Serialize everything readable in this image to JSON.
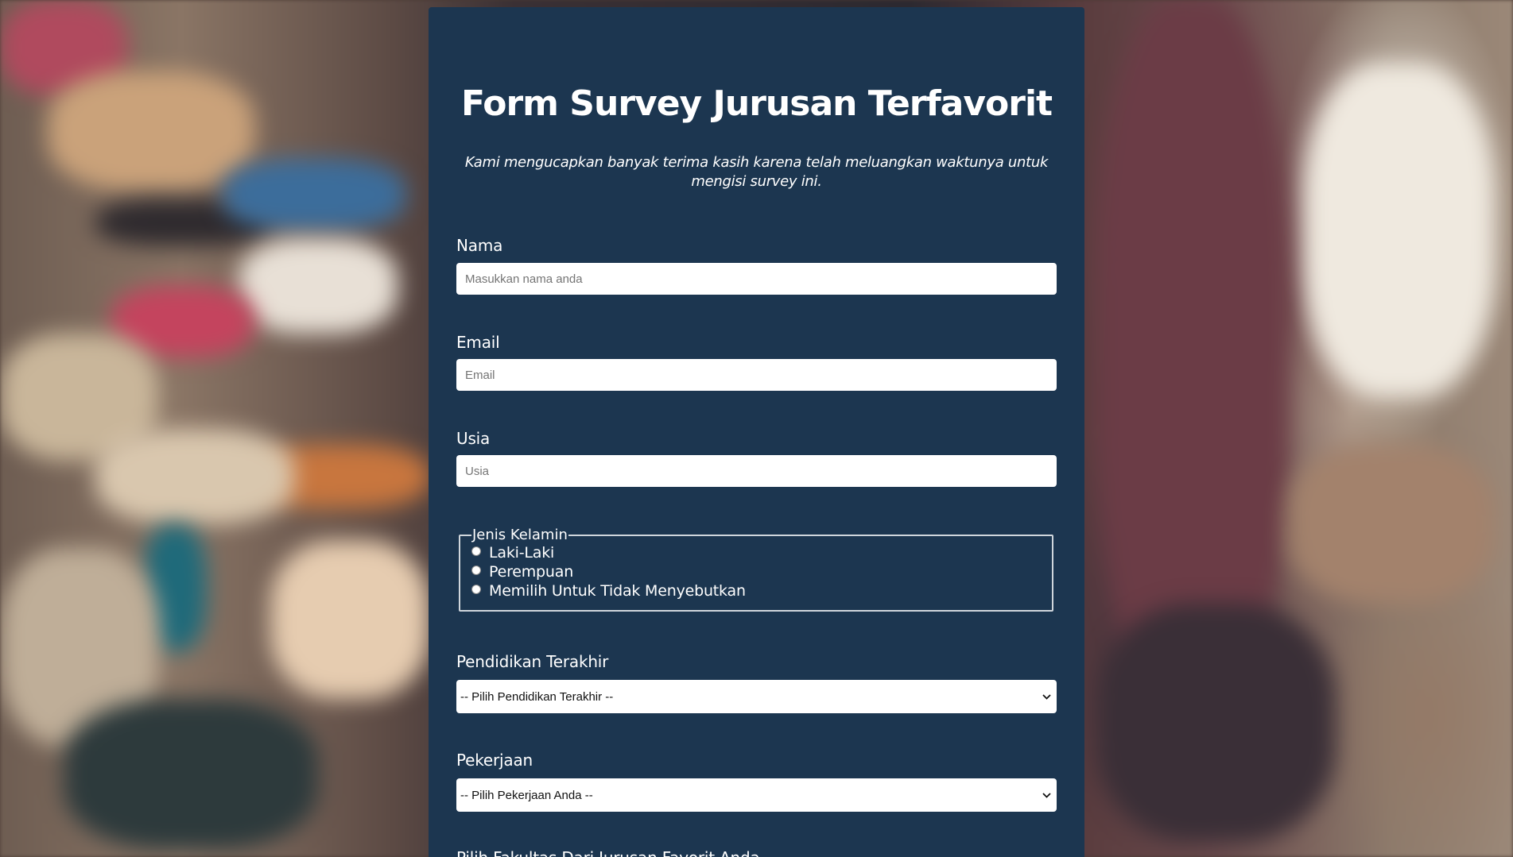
{
  "form": {
    "title": "Form Survey Jurusan Terfavorit",
    "description": "Kami mengucapkan banyak terima kasih karena telah meluangkan waktunya untuk mengisi survey ini.",
    "name": {
      "label": "Nama",
      "placeholder": "Masukkan nama anda"
    },
    "email": {
      "label": "Email",
      "placeholder": "Email"
    },
    "age": {
      "label": "Usia",
      "placeholder": "Usia"
    },
    "gender": {
      "legend": "Jenis Kelamin",
      "options": [
        "Laki-Laki",
        "Perempuan",
        "Memilih Untuk Tidak Menyebutkan"
      ]
    },
    "education": {
      "label": "Pendidikan Terakhir",
      "selected": "-- Pilih Pendidikan Terakhir --"
    },
    "job": {
      "label": "Pekerjaan",
      "selected": "-- Pilih Pekerjaan Anda --"
    },
    "faculty": {
      "label": "Pilih Fakultas Dari Jurusan Favorit Anda"
    }
  },
  "icons": {
    "select_arrow": "chevron-down-icon"
  },
  "colors": {
    "card_background": "#1c3650",
    "text": "#ffffff",
    "input_background": "#ffffff"
  }
}
